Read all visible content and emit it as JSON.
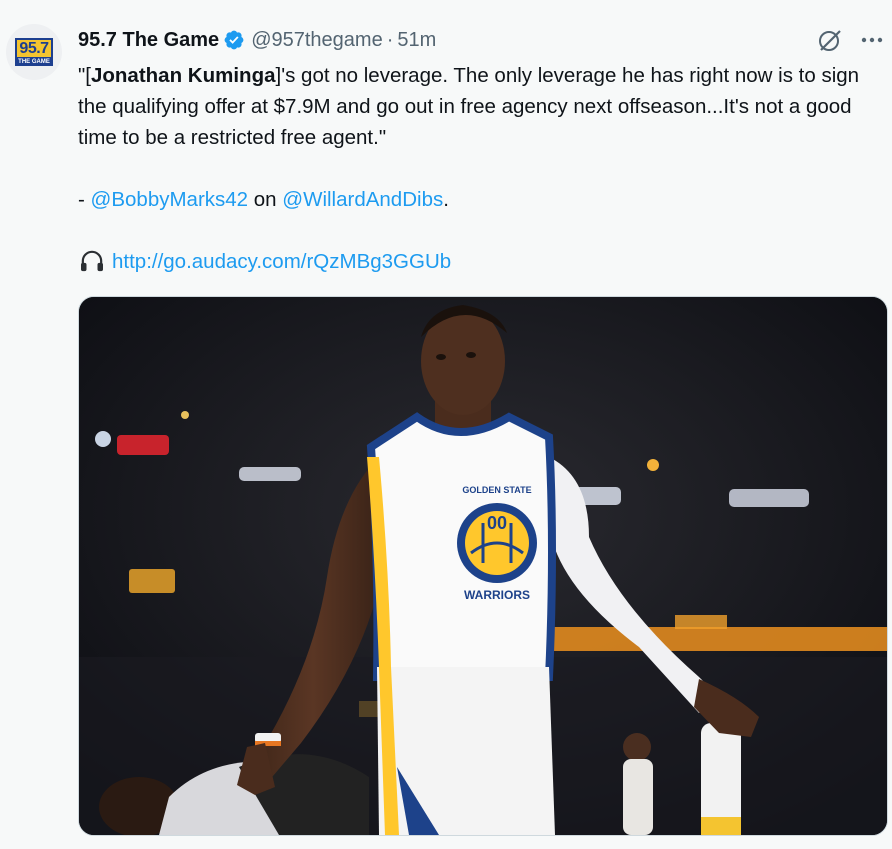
{
  "tweet": {
    "author": {
      "display_name": "95.7 The Game",
      "handle": "@957thegame",
      "separator": "·",
      "time": "51m",
      "logo_number": "95.7",
      "logo_sub": "THE GAME"
    },
    "text": {
      "line1_open": "\"[",
      "line1_bold": "Jonathan Kuminga",
      "line1_rest": "]'s got no leverage. The only leverage he has right now is to sign the qualifying offer at $7.9M and go out in free agency next offseason...It's not a good time to be a restricted free agent.\"",
      "credit_prefix": "- ",
      "mention1": "@BobbyMarks42",
      "credit_middle": " on ",
      "mention2": "@WillardAndDibs",
      "credit_suffix": ".",
      "url": "http://go.audacy.com/rQzMBg3GGUb"
    },
    "media": {
      "jersey_team_top": "GOLDEN STATE",
      "jersey_team_bottom": "WARRIORS",
      "jersey_number": "00"
    }
  },
  "colors": {
    "link": "#1d9bf0",
    "verified": "#1d9bf0",
    "secondary_text": "#536471",
    "jersey_blue": "#1d428a",
    "jersey_gold": "#ffc72c"
  },
  "icons": [
    "verified-badge-icon",
    "grok-icon",
    "more-icon",
    "headphones-icon"
  ]
}
